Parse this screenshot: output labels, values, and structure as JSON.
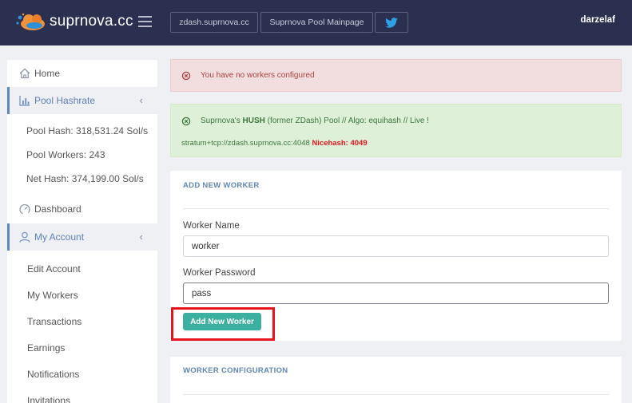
{
  "header": {
    "brand": "suprnova.cc",
    "buttons": [
      "zdash.suprnova.cc",
      "Suprnova Pool Mainpage"
    ],
    "username": "darzelaf"
  },
  "sidebar": {
    "home": "Home",
    "pool_hashrate": "Pool Hashrate",
    "stats": {
      "pool_hash": "Pool Hash: 318,531.24 Sol/s",
      "pool_workers": "Pool Workers: 243",
      "net_hash": "Net Hash: 374,199.00 Sol/s"
    },
    "dashboard": "Dashboard",
    "my_account": "My Account",
    "account_links": [
      "Edit Account",
      "My Workers",
      "Transactions",
      "Earnings",
      "Notifications",
      "Invitations"
    ]
  },
  "alerts": {
    "error": "You have no workers configured",
    "info_prefix": "Suprnova's ",
    "info_bold": "HUSH",
    "info_suffix": " (former ZDash) Pool // Algo: equihash // Live !",
    "stratum": "stratum+tcp://zdash.suprnova.cc:4048",
    "nicehash": "Nicehash: 4049"
  },
  "add_worker": {
    "title": "ADD NEW WORKER",
    "name_label": "Worker Name",
    "name_value": "worker",
    "password_label": "Worker Password",
    "password_value": "pass",
    "button": "Add New Worker"
  },
  "worker_config": {
    "title": "WORKER CONFIGURATION"
  },
  "colors": {
    "topbar": "#2b3050",
    "accent": "#3cb0a0",
    "highlight": "#e8141d"
  }
}
